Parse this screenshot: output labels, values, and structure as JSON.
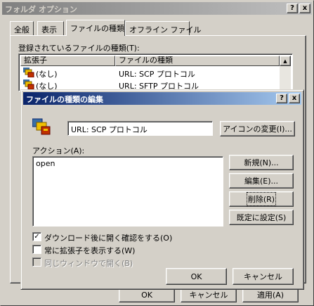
{
  "main_window": {
    "title": "フォルダ オプション",
    "help_glyph": "?",
    "close_glyph": "x",
    "tabs": [
      "全般",
      "表示",
      "ファイルの種類",
      "オフライン ファイル"
    ],
    "registered_label": "登録されているファイルの種類(T):",
    "columns": [
      "拡張子",
      "ファイルの種類"
    ],
    "rows": [
      {
        "ext": "(なし)",
        "type": "URL: SCP プロトコル"
      },
      {
        "ext": "(なし)",
        "type": "URL: SFTP プロトコル"
      }
    ],
    "hidden_button_labels": [
      "OK",
      "キャンセル",
      "適用(A)"
    ]
  },
  "edit_dialog": {
    "title": "ファイルの種類の編集",
    "help_glyph": "?",
    "close_glyph": "x",
    "type_name_value": "URL: SCP プロトコル",
    "change_icon_label": "アイコンの変更(I)...",
    "actions_label": "アクション(A):",
    "actions": [
      "open"
    ],
    "new_label": "新規(N)...",
    "edit_label": "編集(E)...",
    "delete_label": "削除(R)",
    "set_default_label": "既定に設定(S)",
    "confirm_open_label": "ダウンロード後に開く確認をする(O)",
    "confirm_open_checked": true,
    "always_show_ext_label": "常に拡張子を表示する(W)",
    "always_show_ext_checked": false,
    "same_window_label": "同じウィンドウで開く(B)",
    "same_window_checked": false,
    "ok_label": "OK",
    "cancel_label": "キャンセル"
  },
  "colors": {
    "face": "#d4d0c8",
    "inactive_title_start": "#808080",
    "inactive_title_end": "#c0c0c0",
    "active_title_start": "#0a246a",
    "active_title_end": "#a6caf0"
  }
}
